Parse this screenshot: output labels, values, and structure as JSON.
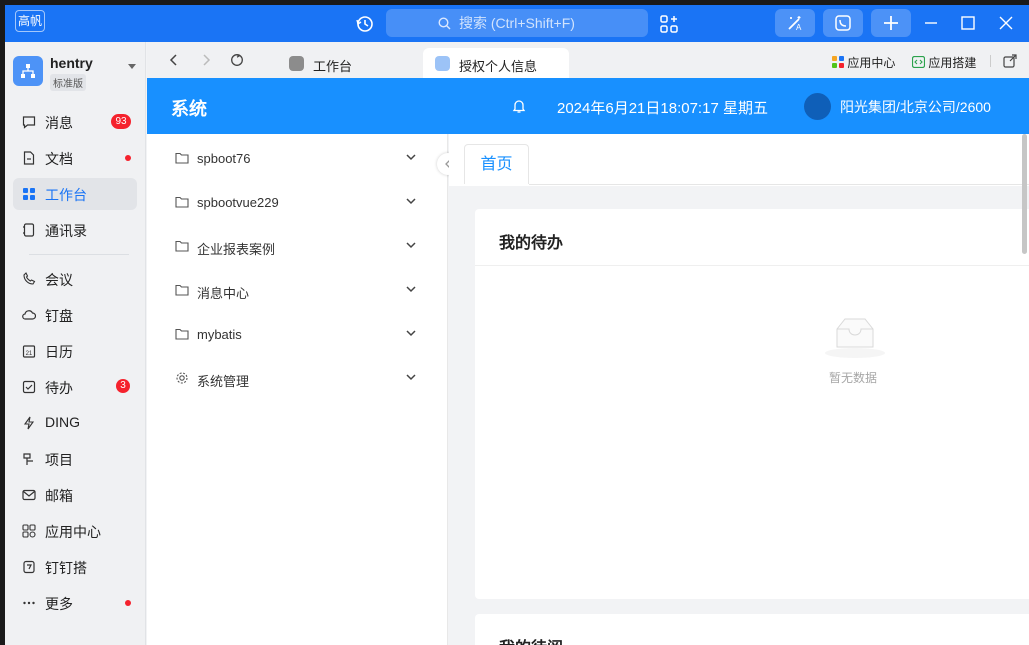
{
  "titlebar": {
    "brand": "高帆",
    "search_placeholder": "搜索 (Ctrl+Shift+F)"
  },
  "user": {
    "name": "hentry",
    "edition": "标准版"
  },
  "sidebar": {
    "items": [
      {
        "label": "消息",
        "badge": "93"
      },
      {
        "label": "文档"
      },
      {
        "label": "工作台"
      },
      {
        "label": "通讯录"
      },
      {
        "label": "会议"
      },
      {
        "label": "钉盘"
      },
      {
        "label": "日历"
      },
      {
        "label": "待办",
        "badge": "3"
      },
      {
        "label": "DING"
      },
      {
        "label": "项目"
      },
      {
        "label": "邮箱"
      },
      {
        "label": "应用中心"
      },
      {
        "label": "钉钉搭"
      },
      {
        "label": "更多"
      }
    ]
  },
  "tabs": {
    "workbench": "工作台",
    "active": "授权个人信息",
    "app_center": "应用中心",
    "app_builder": "应用搭建"
  },
  "header": {
    "title": "系统",
    "datetime": "2024年6月21日18:07:17 星期五",
    "org": "阳光集团/北京公司/2600"
  },
  "menu": {
    "items": [
      "spboot76",
      "spbootvue229",
      "企业报表案例",
      "消息中心",
      "mybatis",
      "系统管理"
    ]
  },
  "content": {
    "page_tab": "首页",
    "todo_title": "我的待办",
    "empty_text": "暂无数据",
    "read_title": "我的待阅"
  },
  "colors": {
    "titlebar": "#1a74f5",
    "header": "#1890ff",
    "badge": "#f5222d",
    "active": "#1a74f5"
  }
}
